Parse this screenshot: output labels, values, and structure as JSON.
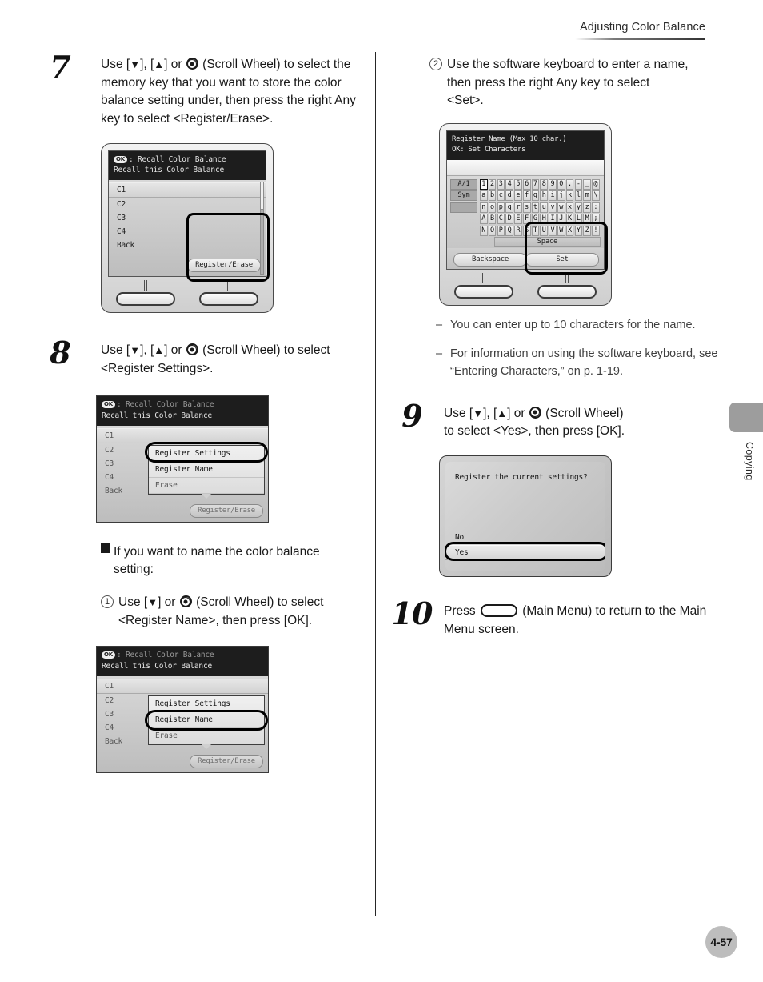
{
  "header": {
    "running_title": "Adjusting Color Balance"
  },
  "side_tab": {
    "label": "Copying"
  },
  "footer": {
    "page_number": "4-57"
  },
  "left_column": {
    "step7": {
      "number": "7",
      "text": "Use [▼], [▲] or  (Scroll Wheel) to select the memory key that you want to store the color balance setting under, then press the right Any key to select <Register/Erase>.",
      "figure": {
        "title_line1": ": Recall Color Balance",
        "title_ok": "OK",
        "title_line2": "Recall this Color Balance",
        "items": [
          "C1",
          "C2",
          "C3",
          "C4",
          "Back"
        ],
        "softkey_right": "Register/Erase"
      }
    },
    "step8": {
      "number": "8",
      "text": "Use [▼], [▲] or  (Scroll Wheel) to select <Register Settings>.",
      "figure": {
        "title_ok": "OK",
        "title_line1": ": Recall Color Balance",
        "title_line2": "Recall this Color Balance",
        "items": [
          "C1",
          "C2",
          "C3",
          "C4",
          "Back"
        ],
        "popup_items": [
          "Register Settings",
          "Register Name",
          "Erase"
        ],
        "popup_selected": "Register Settings",
        "softkey_right": "Register/Erase"
      }
    },
    "note_head": {
      "line1": "If you want to name the color balance",
      "line2": "setting:"
    },
    "substep1": {
      "marker": "1",
      "line1": "Use [▼] or  (Scroll Wheel) to select",
      "line2": "<Register Name>, then press [OK].",
      "figure": {
        "title_ok": "OK",
        "title_line1": ": Recall Color Balance",
        "title_line2": "Recall this Color Balance",
        "items": [
          "C1",
          "C2",
          "C3",
          "C4",
          "Back"
        ],
        "popup_items": [
          "Register Settings",
          "Register Name",
          "Erase"
        ],
        "popup_selected": "Register Name",
        "softkey_right": "Register/Erase"
      }
    }
  },
  "right_column": {
    "substep2": {
      "marker": "2",
      "line1": "Use the software keyboard to enter a name,",
      "line2": "then press the right Any key to select",
      "line3": "<Set>.",
      "figure": {
        "title_line1": "Register Name (Max 10 char.)",
        "title_ok": "OK",
        "title_line2": ": Set Characters",
        "side_keys": [
          "A/1",
          "Sym",
          ""
        ],
        "keyboard_rows": [
          [
            "1",
            "2",
            "3",
            "4",
            "5",
            "6",
            "7",
            "8",
            "9",
            "0",
            ".",
            "-",
            "_",
            "@"
          ],
          [
            "a",
            "b",
            "c",
            "d",
            "e",
            "f",
            "g",
            "h",
            "i",
            "j",
            "k",
            "l",
            "m",
            "\\"
          ],
          [
            "n",
            "o",
            "p",
            "q",
            "r",
            "s",
            "t",
            "u",
            "v",
            "w",
            "x",
            "y",
            "z",
            ":"
          ],
          [
            "A",
            "B",
            "C",
            "D",
            "E",
            "F",
            "G",
            "H",
            "I",
            "J",
            "K",
            "L",
            "M",
            ";"
          ],
          [
            "N",
            "O",
            "P",
            "Q",
            "R",
            "S",
            "T",
            "U",
            "V",
            "W",
            "X",
            "Y",
            "Z",
            "!"
          ]
        ],
        "selected_key": "1",
        "space_label": "Space",
        "softkey_left": "Backspace",
        "softkey_right": "Set"
      },
      "notes": [
        "You can enter up to 10 characters for the name.",
        "For information on using the software keyboard, see “Entering Characters,” on p. 1-19."
      ]
    },
    "step9": {
      "number": "9",
      "line1": "Use [▼], [▲] or  (Scroll Wheel)",
      "line2": "to select <Yes>, then press [OK].",
      "figure": {
        "question": "Register the current settings?",
        "option_no": "No",
        "option_yes": "Yes",
        "selected": "Yes"
      }
    },
    "step10": {
      "number": "10",
      "text_before": "Press",
      "text_after": "(Main Menu) to return to the Main Menu screen."
    }
  },
  "colors": {
    "lcd_header_bg": "#1d1d1d",
    "lcd_body_bg": "#cfcfcf",
    "highlight_outline": "#000000",
    "side_tab": "#9d9d9d",
    "page_badge": "#bdbdbd"
  }
}
